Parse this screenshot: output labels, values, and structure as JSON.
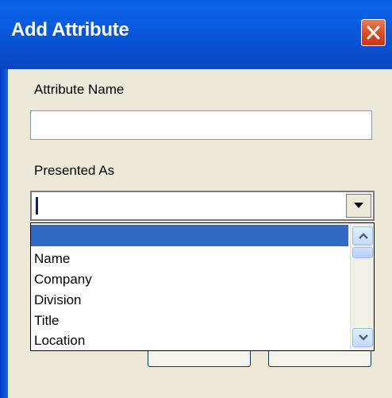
{
  "dialog": {
    "title": "Add Attribute",
    "title_bar_color": "#0a54d6",
    "close_icon": "close-icon"
  },
  "attribute_name": {
    "label": "Attribute Name",
    "value": ""
  },
  "presented_as": {
    "label": "Presented As",
    "selected_value": "",
    "dropdown_icon": "chevron-down-icon",
    "options": [
      "",
      "Name",
      "Company",
      "Division",
      "Title",
      "Location"
    ],
    "selected_index": 0,
    "highlight_color": "#316ac5"
  },
  "scrollbar": {
    "up_icon": "chevron-up-icon",
    "down_icon": "chevron-down-icon"
  }
}
